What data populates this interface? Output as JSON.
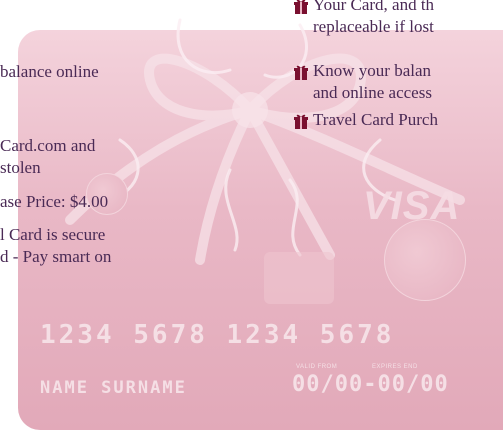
{
  "left_column": {
    "line1": "balance online",
    "line2": "Card.com and",
    "line3": "stolen",
    "line4": "ase Price: $4.00",
    "line5": "l Card is secure",
    "line6": "d - Pay smart on"
  },
  "right_column": {
    "bullet1_line1": "Your Card, and th",
    "bullet1_line2": "replaceable if lost",
    "bullet2_line1": "Know your balan",
    "bullet2_line2": "and online access",
    "bullet3_line1": "Travel Card Purch"
  },
  "card": {
    "brand": "VISA",
    "number": "1234 5678 1234 5678",
    "name": "NAME SURNAME",
    "valid_from_label": "VALID FROM",
    "expires_end_label": "EXPIRES END",
    "dates": "00/00-00/00"
  },
  "colors": {
    "text": "#4a2a55",
    "gift_icon": "#7a1030",
    "card_pink": "#e9b8c6"
  },
  "icons": {
    "bullet": "gift-icon"
  }
}
